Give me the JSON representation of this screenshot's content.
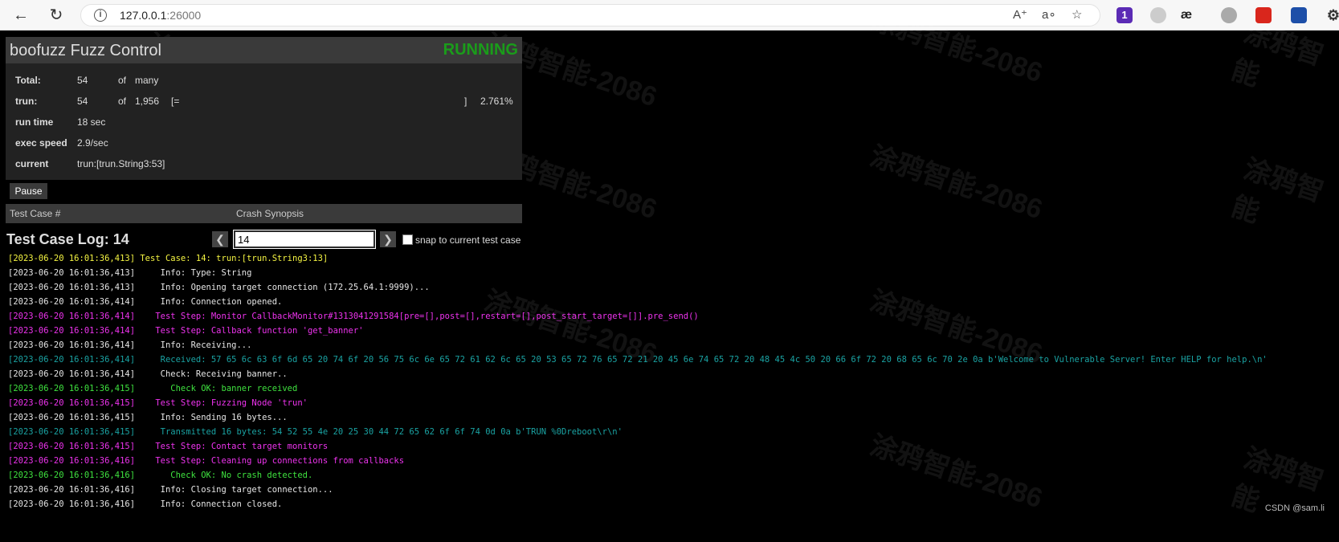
{
  "browser": {
    "url_host": "127.0.0.1",
    "url_port": ":26000",
    "ext_badge": "1"
  },
  "panel": {
    "title": "boofuzz Fuzz Control",
    "status": "RUNNING",
    "total_label": "Total:",
    "total_value": "54",
    "total_of": "of",
    "total_max": "many",
    "trun_label": "trun:",
    "trun_value": "54",
    "trun_of": "of",
    "trun_max": "1,956",
    "trun_bar_left": "[=",
    "trun_bar_right": "]",
    "trun_pct": "2.761%",
    "runtime_label": "run time",
    "runtime_value": "18 sec",
    "speed_label": "exec speed",
    "speed_value": "2.9/sec",
    "current_label": "current",
    "current_value": "trun:[trun.String3:53]"
  },
  "pause_label": "Pause",
  "crash_table": {
    "col1": "Test Case #",
    "col2": "Crash Synopsis"
  },
  "log": {
    "title": "Test Case Log: 14",
    "case_input": "14",
    "snap_label": "snap to current test case",
    "lines": [
      {
        "color": "c-yellow",
        "text": "[2023-06-20 16:01:36,413] Test Case: 14: trun:[trun.String3:13]"
      },
      {
        "color": "c-white",
        "text": "[2023-06-20 16:01:36,413]     Info: Type: String"
      },
      {
        "color": "c-white",
        "text": "[2023-06-20 16:01:36,413]     Info: Opening target connection (172.25.64.1:9999)..."
      },
      {
        "color": "c-white",
        "text": "[2023-06-20 16:01:36,414]     Info: Connection opened."
      },
      {
        "color": "c-magenta",
        "text": "[2023-06-20 16:01:36,414]    Test Step: Monitor CallbackMonitor#1313041291584[pre=[],post=[],restart=[],post_start_target=[]].pre_send()"
      },
      {
        "color": "c-magenta",
        "text": "[2023-06-20 16:01:36,414]    Test Step: Callback function 'get_banner'"
      },
      {
        "color": "c-white",
        "text": "[2023-06-20 16:01:36,414]     Info: Receiving..."
      },
      {
        "color": "c-teal",
        "text": "[2023-06-20 16:01:36,414]     Received: 57 65 6c 63 6f 6d 65 20 74 6f 20 56 75 6c 6e 65 72 61 62 6c 65 20 53 65 72 76 65 72 21 20 45 6e 74 65 72 20 48 45 4c 50 20 66 6f 72 20 68 65 6c 70 2e 0a b'Welcome to Vulnerable Server! Enter HELP for help.\\n'"
      },
      {
        "color": "c-white",
        "text": "[2023-06-20 16:01:36,414]     Check: Receiving banner.."
      },
      {
        "color": "c-green",
        "text": "[2023-06-20 16:01:36,415]       Check OK: banner received"
      },
      {
        "color": "c-magenta",
        "text": "[2023-06-20 16:01:36,415]    Test Step: Fuzzing Node 'trun'"
      },
      {
        "color": "c-white",
        "text": "[2023-06-20 16:01:36,415]     Info: Sending 16 bytes..."
      },
      {
        "color": "c-teal",
        "text": "[2023-06-20 16:01:36,415]     Transmitted 16 bytes: 54 52 55 4e 20 25 30 44 72 65 62 6f 6f 74 0d 0a b'TRUN %0Dreboot\\r\\n'"
      },
      {
        "color": "c-magenta",
        "text": "[2023-06-20 16:01:36,415]    Test Step: Contact target monitors"
      },
      {
        "color": "c-magenta",
        "text": "[2023-06-20 16:01:36,416]    Test Step: Cleaning up connections from callbacks"
      },
      {
        "color": "c-green",
        "text": "[2023-06-20 16:01:36,416]       Check OK: No crash detected."
      },
      {
        "color": "c-white",
        "text": "[2023-06-20 16:01:36,416]     Info: Closing target connection..."
      },
      {
        "color": "c-white",
        "text": "[2023-06-20 16:01:36,416]     Info: Connection closed."
      }
    ]
  },
  "footer": "CSDN @sam.li"
}
